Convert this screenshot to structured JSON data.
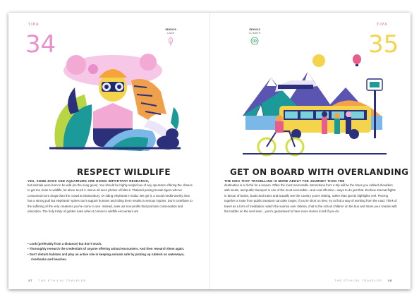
{
  "left_page": {
    "tip_label": "TIPA",
    "tip_number": "34",
    "sdg_label": "SDG#15",
    "sdg_sub": "LAND",
    "title": "RESPECT WILDLIFE",
    "lead": "YES, SOME ZOOS AND AQUARIUMS ARE DOING IMPORTANT RESEARCH,",
    "body": "but animals were born to be wild (so the song goes). You should be highly suspicious of any operators offering the chance to get too close to wildlife, let alone touch it. We've all seen photos of folks in Thailand posing beside tigers who've consumed more drugs than the crowd at Glastonbury. Or riding elephants in India. We get it, a social media-worthy shot has a strong pull but elephants' spines can't support humans and riding them results in serious injuries. Don't contribute to the suffering of the very creatures you've come to see. Instead, seek out non-profits that promote conservation and education. The holy trinity of golden rules when it comes to wildlife encounters are",
    "bullets": [
      "• Look (preferably from a distance) but don't touch.",
      "• Thoroughly research the credentials of anyone offering animal encounters. And then research them again.",
      "• Don't disturb habitats and play an active role in keeping animals safe by picking up rubbish on waterways, riverbanks and beaches."
    ],
    "page_number": "37",
    "running_head": "THE ETHICAL TRAVELER"
  },
  "right_page": {
    "tip_label": "TIPA",
    "tip_number": "35",
    "sdg_label": "SDG#13",
    "sdg_sub": "CLIMATE",
    "title": "GET ON BOARD WITH OVERLANDING",
    "lead": "THE IDEA THAT TRAVELLING IS MORE ABOUT THE JOURNEY THAN THE",
    "body": "destination is a cliché for a reason. Often the most memorable interactions from a trip will be the times you rubbed shoulders with locals, and public transport is one of the most accessible—and cost effective—ways to do just that. Eschew internal flights in favour of buses, boats and trains and actually see the country you're visiting, rather than just its highlights reel. Piecing together a route from public transport can take longer, if you're short on time, try to find a way of working from the road. Think of travel as a form of meditation: watch the sunrise over Siberia, chat to the school children on the bus and share your snacks with the toddler on the next seat... you're guaranteed to have more stories to tell if you do.",
    "page_number": "38",
    "running_head": "THE ETHICAL TRAVELER"
  },
  "colors": {
    "tip34": "#e98fcb",
    "tip35": "#f4d44a",
    "tipa": "#e887c2",
    "lime": "#d3e042",
    "teal": "#1c9a9a",
    "pink": "#f2a9d4",
    "navy": "#1c2a6b",
    "purple": "#5a55b0"
  },
  "icons": [
    "tree-icon",
    "globe-eye-icon"
  ]
}
